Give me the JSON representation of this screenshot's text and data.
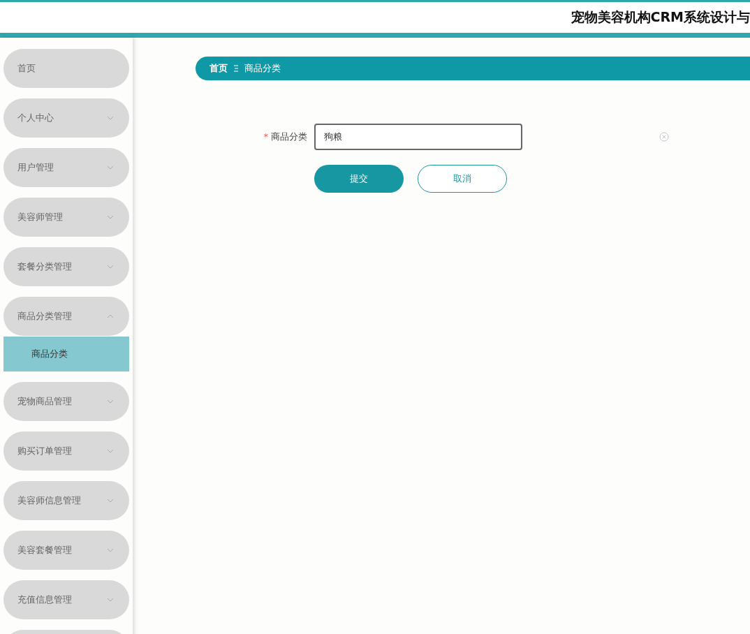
{
  "header": {
    "title": "宠物美容机构CRM系统设计与"
  },
  "sidebar": {
    "items": [
      {
        "label": "首页"
      },
      {
        "label": "个人中心",
        "expanded": false
      },
      {
        "label": "用户管理",
        "expanded": false
      },
      {
        "label": "美容师管理",
        "expanded": false
      },
      {
        "label": "套餐分类管理",
        "expanded": false
      },
      {
        "label": "商品分类管理",
        "expanded": true,
        "children": [
          {
            "label": "商品分类",
            "selected": true
          }
        ]
      },
      {
        "label": "宠物商品管理",
        "expanded": false
      },
      {
        "label": "购买订单管理",
        "expanded": false
      },
      {
        "label": "美容师信息管理",
        "expanded": false
      },
      {
        "label": "美容套餐管理",
        "expanded": false
      },
      {
        "label": "充值信息管理",
        "expanded": false
      }
    ]
  },
  "breadcrumb": [
    "首页",
    "商品分类"
  ],
  "form": {
    "field": {
      "label": "商品分类",
      "required_mark": "*",
      "value": "狗粮"
    },
    "buttons": [
      {
        "label": "提交",
        "kind": "primary"
      },
      {
        "label": "取消",
        "kind": "secondary"
      }
    ]
  }
}
